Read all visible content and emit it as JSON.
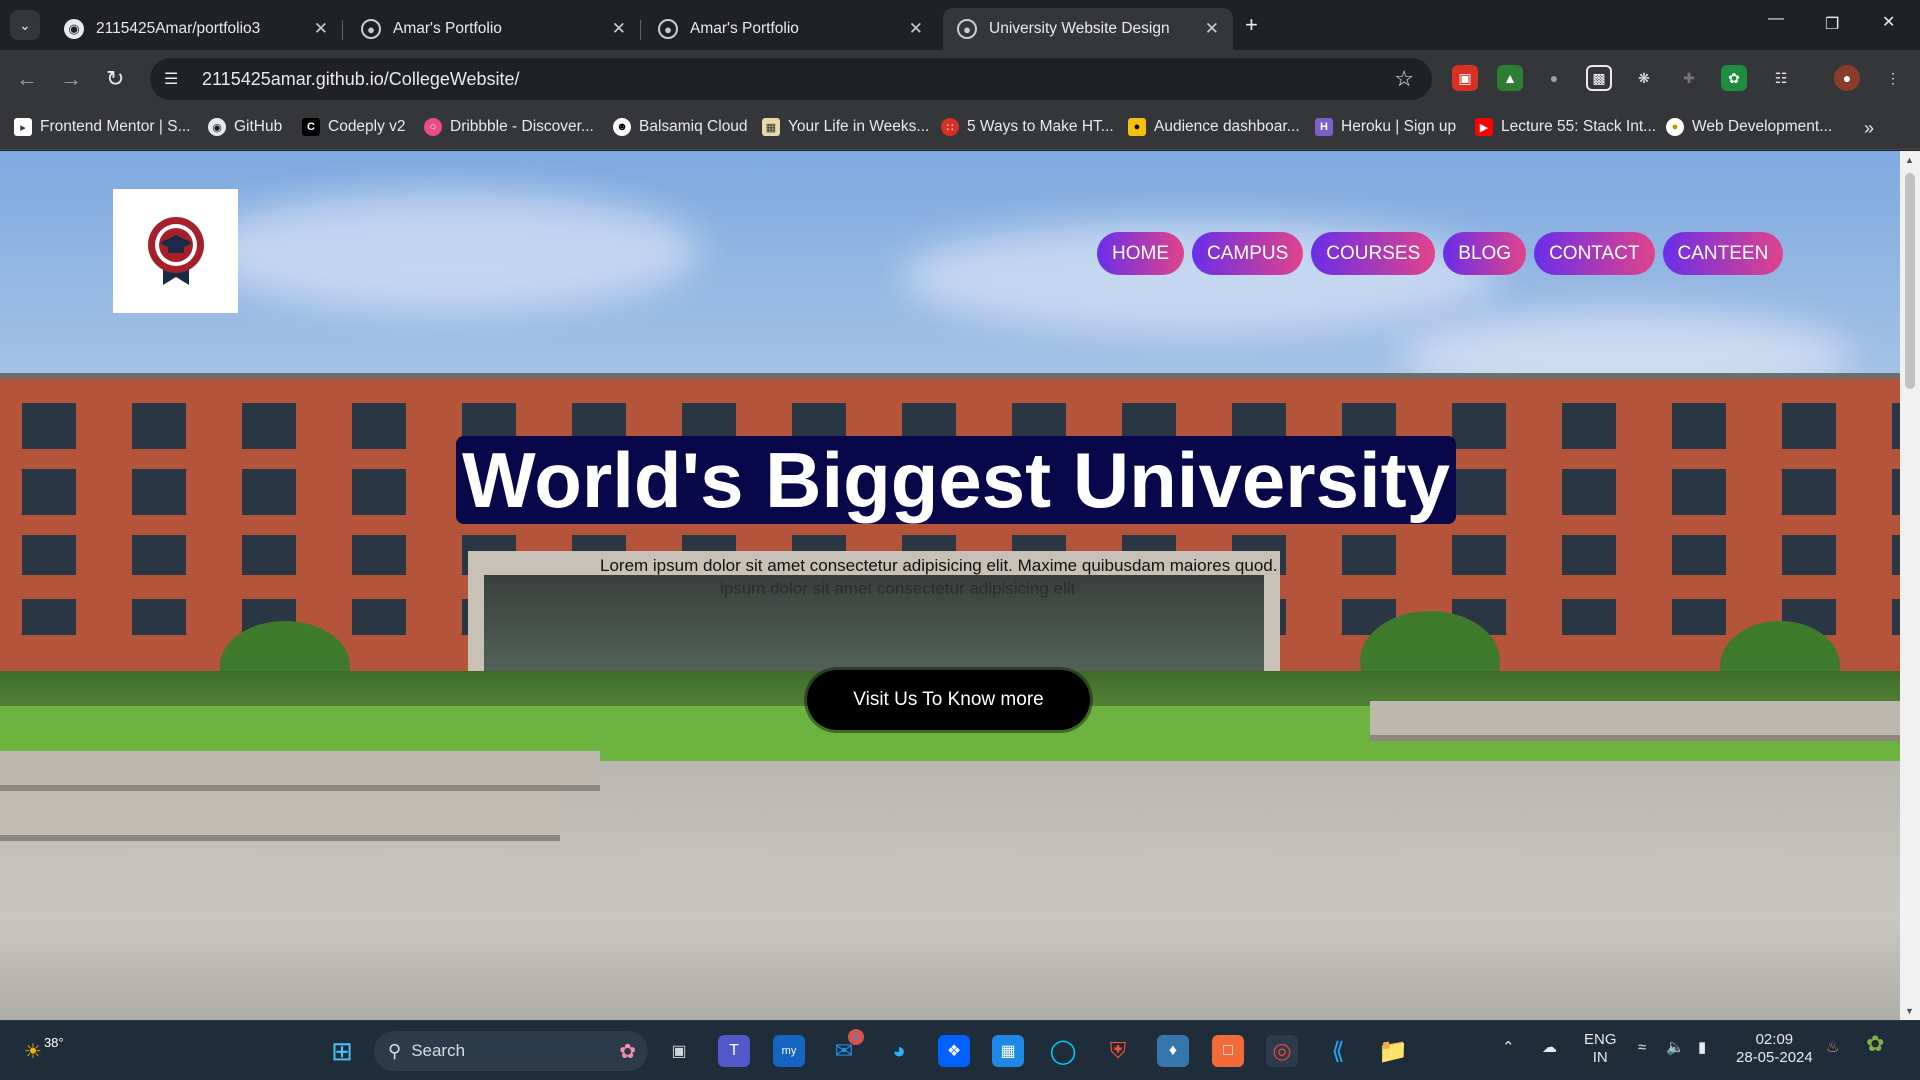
{
  "browser": {
    "tabs": [
      {
        "title": "2115425Amar/portfolio3",
        "icon": "github-icon",
        "active": false
      },
      {
        "title": "Amar's Portfolio",
        "icon": "globe-icon",
        "active": false
      },
      {
        "title": "Amar's Portfolio",
        "icon": "globe-icon",
        "active": false
      },
      {
        "title": "University Website Design",
        "icon": "globe-icon",
        "active": true
      }
    ],
    "url": "2115425amar.github.io/CollegeWebsite/",
    "bookmarks": [
      "Frontend Mentor | S...",
      "GitHub",
      "Codeply v2",
      "Dribbble - Discover...",
      "Balsamiq Cloud",
      "Your Life in Weeks...",
      "5 Ways to Make HT...",
      "Audience dashboar...",
      "Heroku | Sign up",
      "Lecture 55: Stack Int...",
      "Web Development..."
    ]
  },
  "site": {
    "nav": [
      "HOME",
      "CAMPUS",
      "COURSES",
      "BLOG",
      "CONTACT",
      "CANTEEN"
    ],
    "headline": "World's Biggest University",
    "subtext": "Lorem ipsum dolor sit amet consectetur adipisicing elit. Maxime quibusdam maiores quod.",
    "subtext_faded": "ipsum dolor sit amet consectetur adipisicing elit",
    "cta": "Visit Us To Know more",
    "accent_colors": {
      "pill_start": "#6a2ee8",
      "pill_end": "#e0448a",
      "headline_bg": "#07074a"
    }
  },
  "taskbar": {
    "weather": "38°",
    "search_placeholder": "Search",
    "mail_badge": "3",
    "language": "ENG",
    "region": "IN",
    "time": "02:09",
    "date": "28-05-2024"
  }
}
